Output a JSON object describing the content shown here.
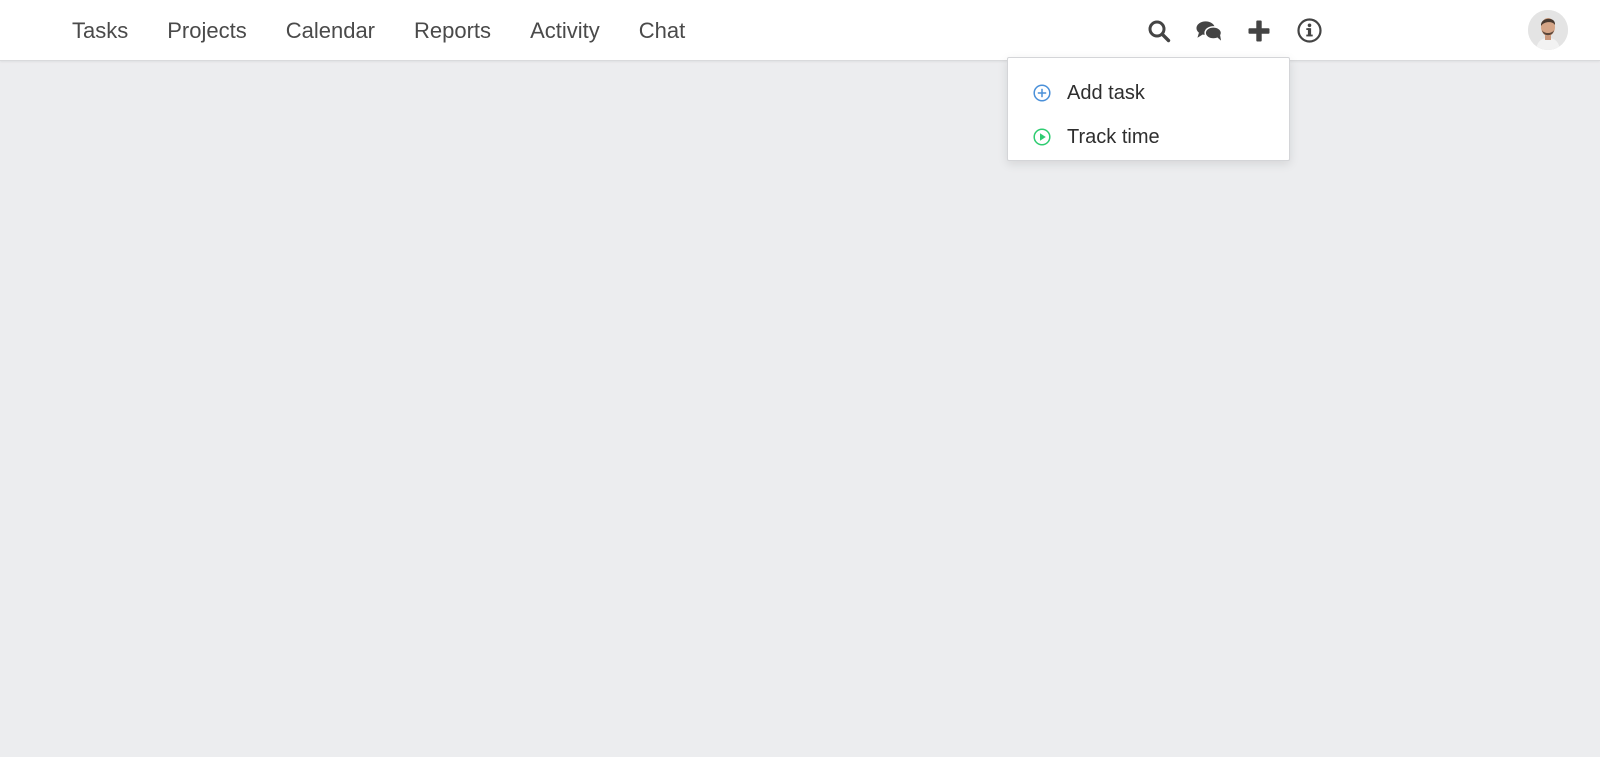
{
  "nav": {
    "items": [
      {
        "label": "Tasks"
      },
      {
        "label": "Projects"
      },
      {
        "label": "Calendar"
      },
      {
        "label": "Reports"
      },
      {
        "label": "Activity"
      },
      {
        "label": "Chat"
      }
    ]
  },
  "toolbar": {
    "icons": [
      "search-icon",
      "chat-bubbles-icon",
      "plus-icon",
      "info-icon"
    ]
  },
  "add_menu": {
    "items": [
      {
        "label": "Add task",
        "icon": "add-circle-icon",
        "color": "#4A90D9"
      },
      {
        "label": "Track time",
        "icon": "play-circle-icon",
        "color": "#2ECC71"
      }
    ]
  },
  "colors": {
    "background": "#ECEDEF",
    "topbar": "#FFFFFF",
    "nav_text": "#4A4A4A",
    "icon": "#444444"
  }
}
